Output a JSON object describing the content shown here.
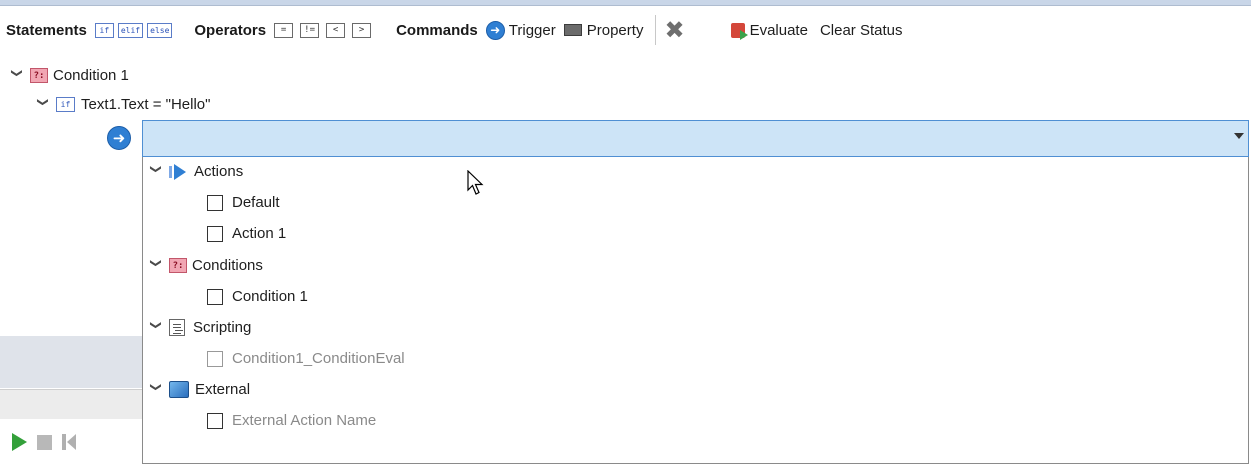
{
  "toolbar": {
    "statements_label": "Statements",
    "statement_buttons": [
      "if",
      "elif",
      "else"
    ],
    "operators_label": "Operators",
    "operator_buttons": [
      "=",
      "!=",
      "<",
      ">"
    ],
    "commands_label": "Commands",
    "trigger_label": "Trigger",
    "property_label": "Property",
    "evaluate_label": "Evaluate",
    "clear_status_label": "Clear Status"
  },
  "tree": {
    "condition_icon": "?:",
    "condition_label": "Condition 1",
    "if_icon": "if",
    "if_expression": "Text1.Text = \"Hello\""
  },
  "combo": {
    "value": ""
  },
  "dropdown": {
    "groups": [
      {
        "label": "Actions",
        "icon": "action-arrow-icon",
        "items": [
          "Default",
          "Action 1"
        ]
      },
      {
        "label": "Conditions",
        "icon": "condition-icon",
        "items": [
          "Condition 1"
        ]
      },
      {
        "label": "Scripting",
        "icon": "script-icon",
        "items": [
          "Condition1_ConditionEval"
        ]
      },
      {
        "label": "External",
        "icon": "external-icon",
        "items": [
          "External Action Name"
        ]
      }
    ]
  },
  "colors": {
    "combo_fill": "#cde4f7",
    "combo_border": "#4f8fd3",
    "accent_blue": "#2f7fd3"
  }
}
